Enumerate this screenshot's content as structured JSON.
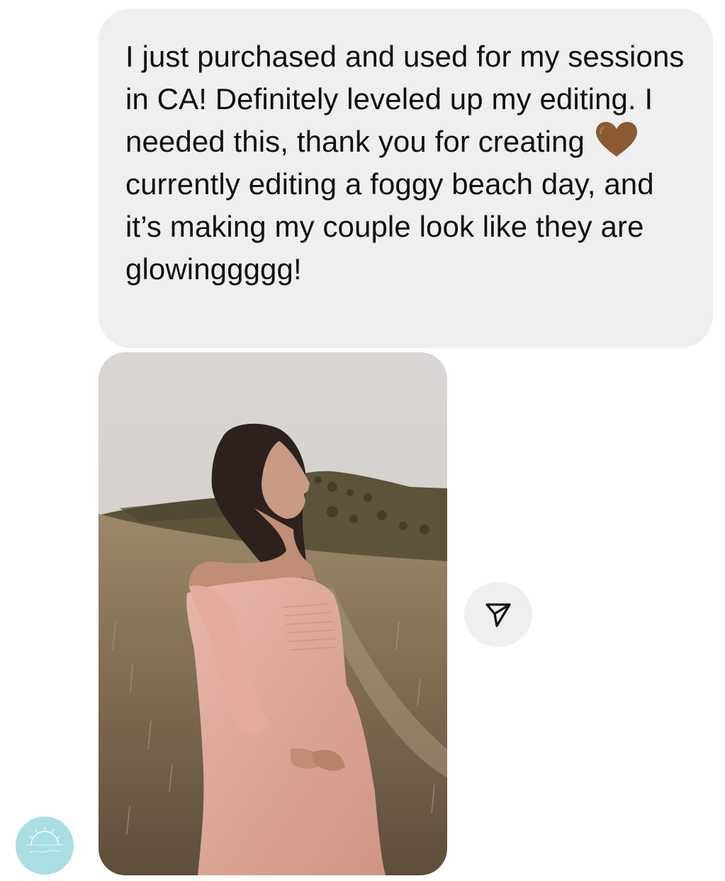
{
  "message": {
    "text_before_emoji": "I just purchased and used for my sessions in CA! Definitely leveled up my editing. I needed this, thank you for creating",
    "emoji": "brown-heart-icon",
    "text_after_emoji": "currently editing a foggy beach day, and it’s making my couple look like they are glowinggggg!"
  },
  "attachment": {
    "type": "photo",
    "subject": "maternity portrait in a hillside field"
  },
  "actions": {
    "share_icon": "send-paper-plane-icon"
  },
  "avatar": {
    "icon": "sun-logo-icon"
  },
  "colors": {
    "bubble": "#efefef",
    "text": "#111111",
    "heart": "#8a5a33",
    "avatar": "#a9dfe2"
  }
}
